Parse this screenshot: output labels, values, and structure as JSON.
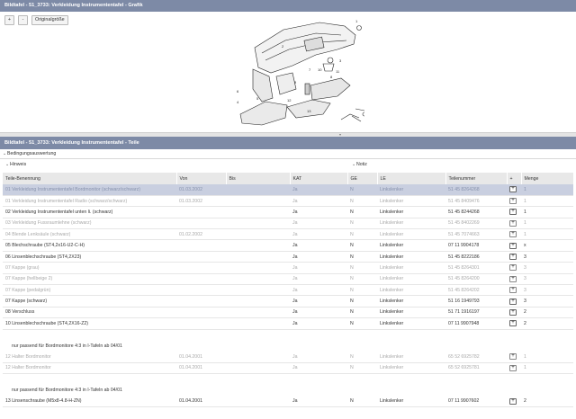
{
  "graphic_panel": {
    "title": "Bildtafel - 51_3733: Verkleidung Instrumententafel - Grafik",
    "zoom_in": "+",
    "zoom_out": "-",
    "original_size": "Originalgröße",
    "callouts": [
      "1",
      "2",
      "3",
      "4",
      "5",
      "6",
      "7",
      "8",
      "9",
      "10",
      "11",
      "12",
      "13"
    ]
  },
  "parts_panel": {
    "title": "Bildtafel - 51_3733: Verkleidung Instrumententafel - Teile",
    "conditions_label": "Bedingungsauswertung",
    "hint_label": "Hinweis",
    "note_label": "Notiz"
  },
  "table": {
    "headers": [
      "Teile-Benennung",
      "Von",
      "Bis",
      "KAT",
      "GE",
      "LE",
      "Teilenummer",
      "+",
      "Menge"
    ],
    "rows": [
      {
        "kind": "sel",
        "name": "01 Verkleidung Instrumententafel Bordmonitor (schwarz/schwarz)",
        "von": "01.03.2002",
        "bis": "",
        "kat": "Ja",
        "ge": "N",
        "le": "Linkslenker",
        "nr": "51 45 8264268",
        "cart": "+",
        "qty": "1"
      },
      {
        "kind": "grey",
        "name": "01 Verkleidung Instrumententafel Radio (schwarz/schwarz)",
        "von": "01.03.2002",
        "bis": "",
        "kat": "Ja",
        "ge": "N",
        "le": "Linkslenker",
        "nr": "51 45 8409476",
        "cart": "+",
        "qty": "1"
      },
      {
        "kind": "normal",
        "name": "02 Verkleidung Instrumententafel unten li. (schwarz)",
        "von": "",
        "bis": "",
        "kat": "Ja",
        "ge": "N",
        "le": "Linkslenker",
        "nr": "51 45 8244268",
        "cart": "+",
        "qty": "1"
      },
      {
        "kind": "grey",
        "name": "03 Verkleidung Fussraumlehne (schwarz)",
        "von": "",
        "bis": "",
        "kat": "Ja",
        "ge": "N",
        "le": "Linkslenker",
        "nr": "51 45 8402269",
        "cart": "+",
        "qty": "1"
      },
      {
        "kind": "grey",
        "name": "04 Blende Lenksäule (schwarz)",
        "von": "01.02.2002",
        "bis": "",
        "kat": "Ja",
        "ge": "N",
        "le": "Linkslenker",
        "nr": "51 45 7074663",
        "cart": "+",
        "qty": "1"
      },
      {
        "kind": "normal",
        "name": "05 Blechschraube (ST4,2x16-U2-C-H)",
        "von": "",
        "bis": "",
        "kat": "Ja",
        "ge": "N",
        "le": "Linkslenker",
        "nr": "07 11 9904178",
        "cart": "+",
        "qty": "x"
      },
      {
        "kind": "normal",
        "name": "06 Linsenblechschraube (ST4,2X23)",
        "von": "",
        "bis": "",
        "kat": "Ja",
        "ge": "N",
        "le": "Linkslenker",
        "nr": "51 45 8222186",
        "cart": "+",
        "qty": "3"
      },
      {
        "kind": "grey",
        "name": "07 Kappe (grau)",
        "von": "",
        "bis": "",
        "kat": "Ja",
        "ge": "N",
        "le": "Linkslenker",
        "nr": "51 45 8264301",
        "cart": "+",
        "qty": "3"
      },
      {
        "kind": "grey",
        "name": "07 Kappe (hellbeige 2)",
        "von": "",
        "bis": "",
        "kat": "Ja",
        "ge": "N",
        "le": "Linkslenker",
        "nr": "51 45 8264200",
        "cart": "+",
        "qty": "3"
      },
      {
        "kind": "grey",
        "name": "07 Kappe (pedalgrün)",
        "von": "",
        "bis": "",
        "kat": "Ja",
        "ge": "N",
        "le": "Linkslenker",
        "nr": "51 45 8264202",
        "cart": "+",
        "qty": "3"
      },
      {
        "kind": "normal",
        "name": "07 Kappe (schwarz)",
        "von": "",
        "bis": "",
        "kat": "Ja",
        "ge": "N",
        "le": "Linkslenker",
        "nr": "51 16 1949793",
        "cart": "+",
        "qty": "3"
      },
      {
        "kind": "normal",
        "name": "08 Verschluss",
        "von": "",
        "bis": "",
        "kat": "Ja",
        "ge": "N",
        "le": "Linkslenker",
        "nr": "51 71 1916197",
        "cart": "+",
        "qty": "2"
      },
      {
        "kind": "normal",
        "name": "10 Linsenblechschraube (ST4,2X16-Z2)",
        "von": "",
        "bis": "",
        "kat": "Ja",
        "ge": "N",
        "le": "Linkslenker",
        "nr": "07 11 9907948",
        "cart": "+",
        "qty": "2"
      },
      {
        "kind": "blank"
      },
      {
        "kind": "note",
        "name": "nur passend für Bordmonitore 4:3 in I-Tafeln ab 04/01"
      },
      {
        "kind": "grey",
        "name": "12 Halter Bordmonitor",
        "von": "01.04.2001",
        "bis": "",
        "kat": "Ja",
        "ge": "N",
        "le": "Linkslenker",
        "nr": "65 52 6925782",
        "cart": "+",
        "qty": "1"
      },
      {
        "kind": "grey",
        "name": "12 Halter Bordmonitor",
        "von": "01.04.2001",
        "bis": "",
        "kat": "Ja",
        "ge": "N",
        "le": "Linkslenker",
        "nr": "65 52 6925781",
        "cart": "+",
        "qty": "1"
      },
      {
        "kind": "blank"
      },
      {
        "kind": "note",
        "name": "nur passend für Bordmonitore 4:3 in I-Tafeln ab 04/01"
      },
      {
        "kind": "normal",
        "name": "13 Linsenschraube (M5x8-4.8-H-ZN)",
        "von": "01.04.2001",
        "bis": "",
        "kat": "Ja",
        "ge": "N",
        "le": "Linkslenker",
        "nr": "07 11 9907602",
        "cart": "+",
        "qty": "2"
      }
    ]
  }
}
